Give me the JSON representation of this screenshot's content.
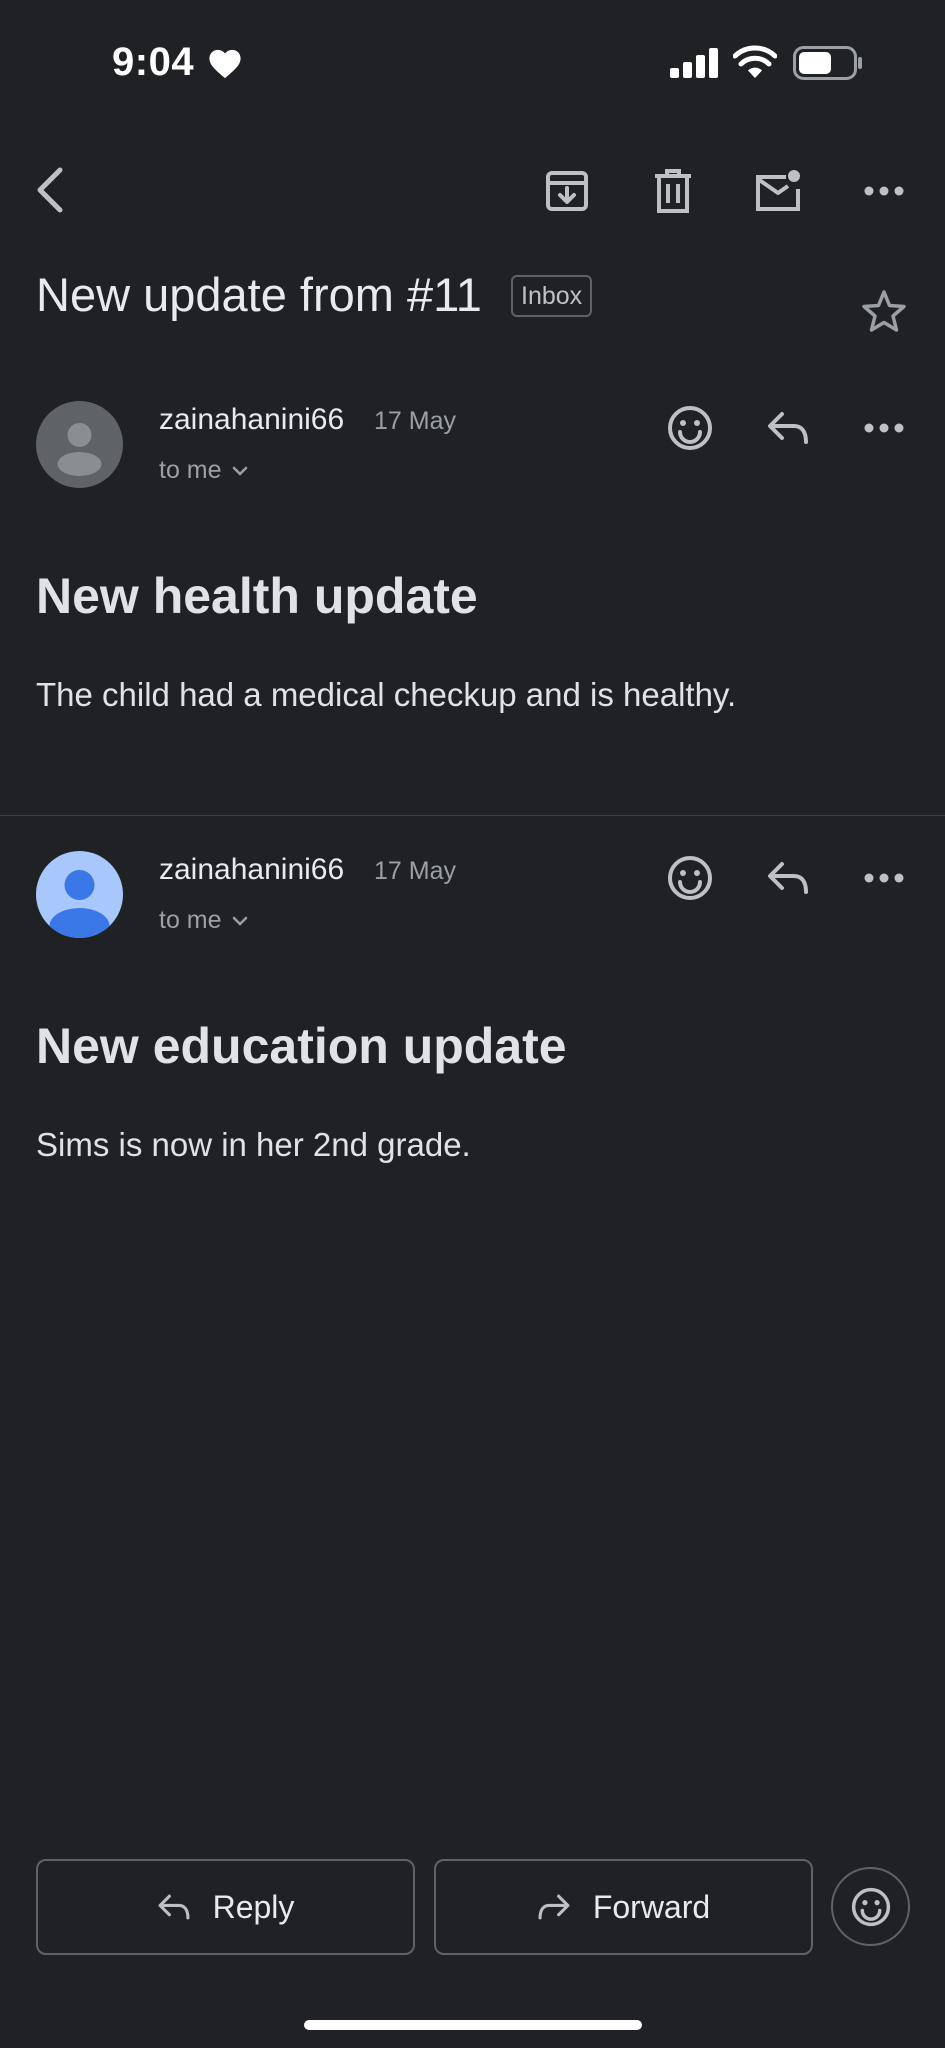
{
  "status_bar": {
    "time": "9:04",
    "icons": [
      "heart-icon",
      "cellular-signal-icon",
      "wifi-icon",
      "battery-icon"
    ]
  },
  "toolbar": {
    "icons": [
      "back-icon",
      "archive-icon",
      "delete-icon",
      "mark-unread-icon",
      "more-icon"
    ]
  },
  "subject": {
    "title": "New update from #11",
    "label": "Inbox",
    "star_icon": "star-icon"
  },
  "messages": [
    {
      "sender": "zainahanini66",
      "date": "17 May",
      "recipient": "to me",
      "heading": "New health update",
      "body": "The child had a medical checkup and is healthy.",
      "avatar": "default-avatar-grey",
      "actions": [
        "emoji-react-icon",
        "reply-icon",
        "more-icon"
      ]
    },
    {
      "sender": "zainahanini66",
      "date": "17 May",
      "recipient": "to me",
      "heading": "New education update",
      "body": "Sims is now in her 2nd grade.",
      "avatar": "default-avatar-blue",
      "actions": [
        "emoji-react-icon",
        "reply-icon",
        "more-icon"
      ]
    }
  ],
  "bottom_actions": {
    "reply_label": "Reply",
    "forward_label": "Forward",
    "emoji_icon": "emoji-react-icon"
  },
  "colors": {
    "background": "#202124",
    "text_primary": "#e8eaed",
    "text_secondary": "#9aa0a6",
    "border": "#5f6368",
    "avatar_blue_bg": "#a8c7fa",
    "avatar_blue_fg": "#3b78e7",
    "avatar_grey_bg": "#5f6368"
  }
}
